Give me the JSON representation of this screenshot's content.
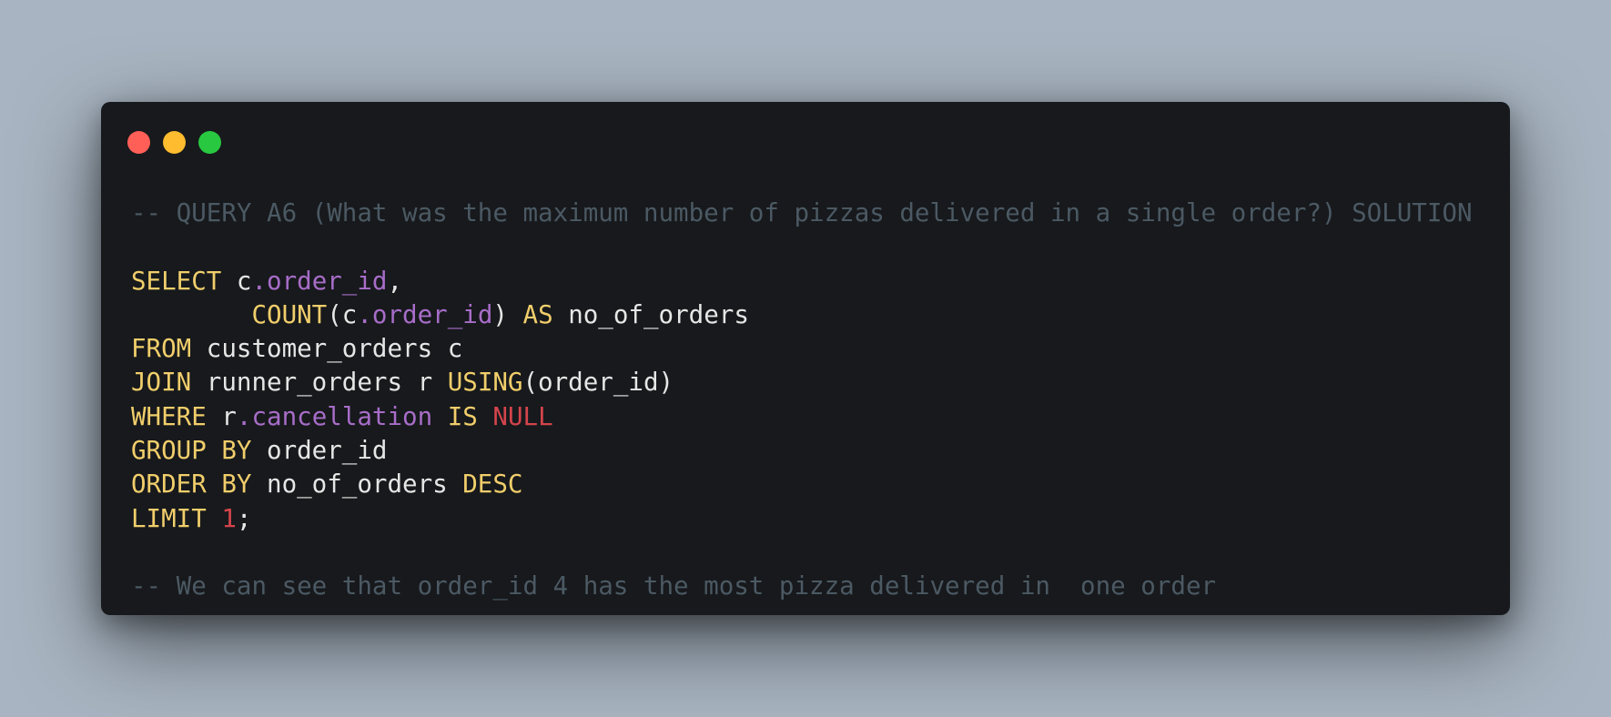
{
  "window": {
    "controls": {
      "close_color": "#ff5f57",
      "minimize_color": "#febc2e",
      "maximize_color": "#28c840"
    }
  },
  "colors": {
    "background": "#a8b4c1",
    "editor": "#17191c",
    "comment": "#4b5963",
    "keyword": "#f1ce6b",
    "property": "#a76dc8",
    "literal": "#d4444c",
    "text": "#e6e6e6"
  },
  "code": {
    "comment_header": "-- QUERY A6 (What was the maximum number of pizzas delivered in a single order?) SOLUTION",
    "l1": {
      "kw": "SELECT",
      "t1": " c",
      "prop": ".order_id",
      "t2": ","
    },
    "l2": {
      "indent": "        ",
      "fn": "COUNT",
      "t1": "(c",
      "prop": ".order_id",
      "t2": ") ",
      "kw": "AS",
      "t3": " no_of_orders"
    },
    "l3": {
      "kw": "FROM",
      "t1": " customer_orders c"
    },
    "l4": {
      "kw": "JOIN",
      "t1": " runner_orders r ",
      "fn": "USING",
      "t2": "(order_id)"
    },
    "l5": {
      "kw": "WHERE",
      "t1": " r",
      "prop": ".cancellation",
      "t2": " ",
      "kw2": "IS",
      "t3": " ",
      "lit": "NULL"
    },
    "l6": {
      "kw": "GROUP BY",
      "t1": " order_id"
    },
    "l7": {
      "kw": "ORDER BY",
      "t1": " no_of_orders ",
      "kw2": "DESC"
    },
    "l8": {
      "kw": "LIMIT",
      "t1": " ",
      "lit": "1",
      "t2": ";"
    },
    "comment_footer": "-- We can see that order_id 4 has the most pizza delivered in  one order"
  }
}
